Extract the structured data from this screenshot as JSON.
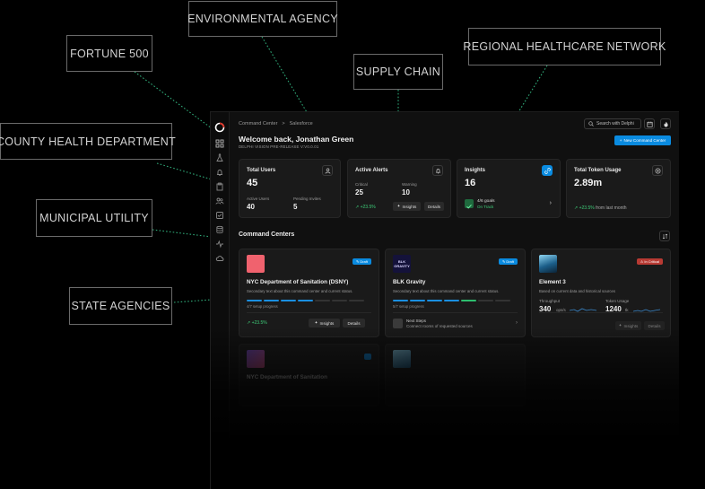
{
  "callouts": {
    "environmental": "ENVIRONMENTAL AGENCY",
    "fortune": "FORTUNE 500",
    "supply": "SUPPLY CHAIN",
    "regional": "REGIONAL HEALTHCARE NETWORK",
    "county": "COUNTY HEALTH DEPARTMENT",
    "municipal": "MUNICIPAL UTILITY",
    "state": "STATE AGENCIES"
  },
  "colors": {
    "accent": "#0a8be0",
    "connector": "#2fa877",
    "positive": "#3ecf7a",
    "danger": "#d9443a",
    "draft": "#0a8be0"
  },
  "breadcrumb": {
    "root": "Command Center",
    "separator": ">",
    "current": "Salesforce"
  },
  "search": {
    "label": "Search with Delphi"
  },
  "header": {
    "welcome": "Welcome back, Jonathan Green",
    "subtitle": "DELPHI VISION PRE-RELEASE V:V0.0.01",
    "new_button": "New Command Center"
  },
  "kpis": {
    "users": {
      "title": "Total Users",
      "value": "45",
      "active_label": "Active Users",
      "active_value": "40",
      "pending_label": "Pending Invites",
      "pending_value": "5"
    },
    "alerts": {
      "title": "Active Alerts",
      "critical_label": "Critical",
      "critical_value": "25",
      "warning_label": "Warning",
      "warning_value": "10",
      "change": "+23.5%",
      "insights": "Insights",
      "details": "Details"
    },
    "insights": {
      "title": "Insights",
      "value": "16",
      "goals": "4/6 goals",
      "status": "On Track",
      "chevron": "›"
    },
    "tokens": {
      "title": "Total Token Usage",
      "value": "2.89m",
      "change": "+23.5%",
      "change_suffix": "from last month"
    }
  },
  "section": {
    "title": "Command Centers"
  },
  "centers": [
    {
      "title": "NYC Department of Sanitation (DSNY)",
      "desc": "Secondary text about this command center and current status.",
      "badge": "Draft",
      "progress": "4/7 setup progress",
      "change": "+23.5%",
      "insights": "Insights",
      "details": "Details"
    },
    {
      "title": "BLK Gravity",
      "desc": "Secondary text about this command center and current status.",
      "badge": "Draft",
      "progress": "5/7 setup progress",
      "logo_text": "BLK GRAVITY",
      "next_title": "Next Steps",
      "next_desc": "Connect rooms of requested sources"
    },
    {
      "title": "Element 3",
      "desc": "Based on current data and historical sources",
      "badge": "In Critical",
      "throughput_label": "Throughput",
      "throughput_value": "340",
      "throughput_unit": "ops/s",
      "token_label": "Token Usage",
      "token_value": "1240",
      "token_unit": "tk",
      "insights": "Insights",
      "details": "Details"
    }
  ],
  "faded": {
    "title": "NYC Department of Sanitation"
  }
}
